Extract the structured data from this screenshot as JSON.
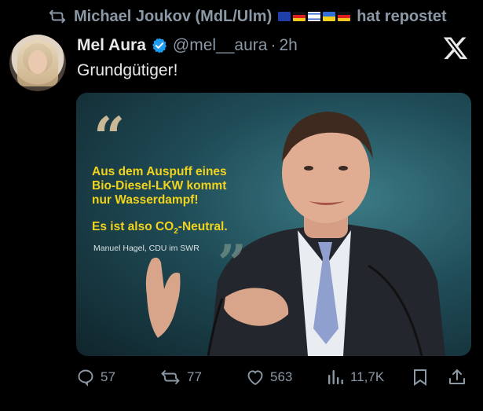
{
  "repost": {
    "reposter": "Michael Joukov (MdL/Ulm)",
    "flags": [
      "eu-flag",
      "germany-flag",
      "israel-flag",
      "ukraine-flag",
      "germany-flag"
    ],
    "suffix": "hat repostet"
  },
  "tweet": {
    "author_name": "Mel Aura",
    "handle": "@mel__aura",
    "separator": "·",
    "time": "2h",
    "text": "Grundgütiger!"
  },
  "media": {
    "quote_lines": "Aus dem Auspuff eines\nBio-Diesel-LKW kommt\nnur Wasserdampf!",
    "claim_prefix": "Es ist also CO",
    "claim_sub": "2",
    "claim_suffix": "-Neutral.",
    "attribution": "Manuel Hagel, CDU im SWR"
  },
  "actions": {
    "replies": "57",
    "reposts": "77",
    "likes": "563",
    "views": "11,7K"
  },
  "colors": {
    "background": "#000000",
    "muted": "#8b98a5",
    "verified": "#1d9bf0",
    "quote_yellow": "#f2d31c"
  }
}
